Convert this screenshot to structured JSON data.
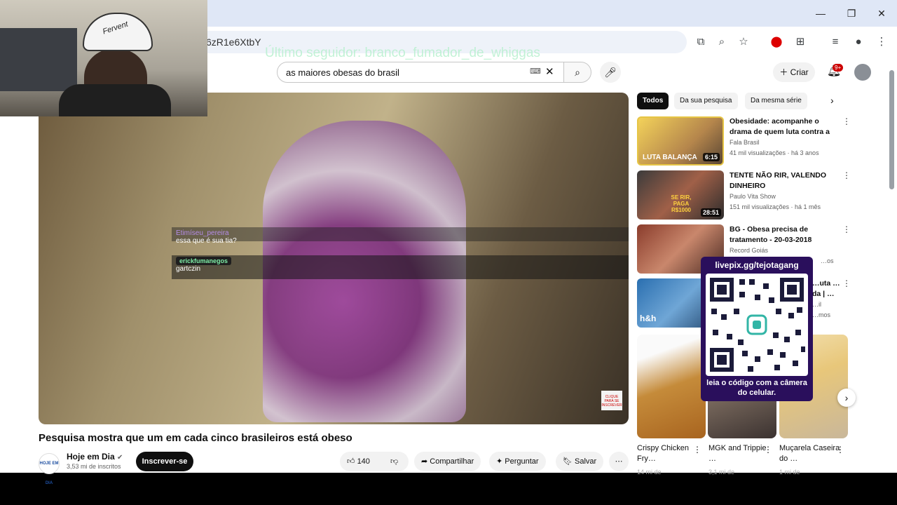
{
  "browser": {
    "url_fragment": "6zR1e6XtbY",
    "window_controls": [
      "—",
      "❐",
      "✕"
    ]
  },
  "overlay": {
    "ticker": "Último seguidor: branco_fumador_de_whiggas",
    "webcam_cap_text": "Fervent",
    "chat": [
      {
        "user": "Etimíseu_pereira",
        "message": "essa que é sua tia?"
      },
      {
        "user": "erickfumanegos",
        "message": "gartczin"
      }
    ],
    "qr": {
      "link": "livepix.gg/tejotagang",
      "caption": "leia o código com a câmera do celular."
    }
  },
  "youtube": {
    "search_query": "as maiores obesas do brasil",
    "create_label": "Criar",
    "notif_badge": "9+",
    "video": {
      "title": "Pesquisa mostra que um em cada cinco brasileiros está obeso",
      "channel": "Hoje em Dia",
      "channel_logo_text": "HOJE EM DIA",
      "subscribers": "3,53 mi de inscritos",
      "subscribe_label": "Inscrever-se",
      "likes": "140",
      "share_label": "Compartilhar",
      "ask_label": "Perguntar",
      "save_label": "Salvar",
      "watermark": "CLIQUE PARA SE INSCREVER"
    },
    "chips": [
      "Todos",
      "Da sua pesquisa",
      "Da mesma série"
    ],
    "recommendations": [
      {
        "title": "Obesidade: acompanhe o drama de quem luta contra a balança",
        "channel": "Fala Brasil",
        "meta": "41 mil visualizações · há 3 anos",
        "duration": "6:15",
        "thumb_text": "LUTA BALANÇA"
      },
      {
        "title": "TENTE NÃO RIR, VALENDO DINHEIRO",
        "channel": "Paulo Vita Show",
        "meta": "151 mil visualizações · há 1 mês",
        "duration": "28:51",
        "thumb_text": "SE RIR, PAGA R$1000"
      },
      {
        "title": "BG - Obesa precisa de tratamento - 20-03-2018",
        "channel": "Record Goiás",
        "meta": "…os",
        "duration": "",
        "thumb_text": ""
      },
      {
        "title": "…uta …da | …",
        "channel": "…il",
        "meta": "…mos",
        "duration": "",
        "thumb_text": "h&h"
      }
    ],
    "shorts": [
      {
        "title": "Crispy Chicken Fry…",
        "views": "14 mi de"
      },
      {
        "title": "MGK and Trippie …",
        "views": "3,1 mi de"
      },
      {
        "title": "Muçarela Caseira do …",
        "views": "1 mi de"
      }
    ]
  }
}
